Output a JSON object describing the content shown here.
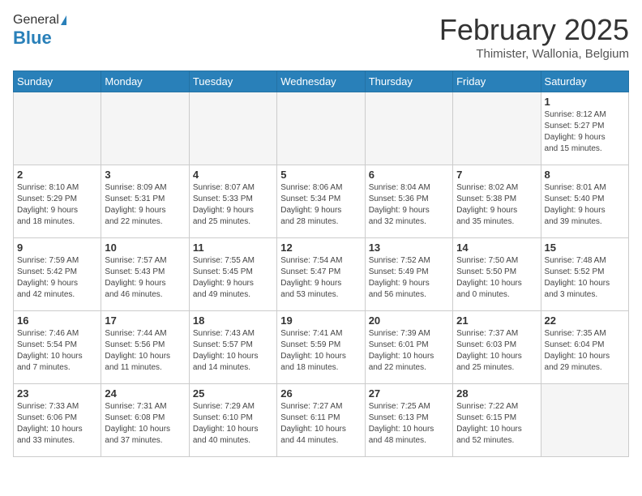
{
  "header": {
    "logo_general": "General",
    "logo_blue": "Blue",
    "month_title": "February 2025",
    "location": "Thimister, Wallonia, Belgium"
  },
  "weekdays": [
    "Sunday",
    "Monday",
    "Tuesday",
    "Wednesday",
    "Thursday",
    "Friday",
    "Saturday"
  ],
  "weeks": [
    [
      {
        "day": "",
        "info": ""
      },
      {
        "day": "",
        "info": ""
      },
      {
        "day": "",
        "info": ""
      },
      {
        "day": "",
        "info": ""
      },
      {
        "day": "",
        "info": ""
      },
      {
        "day": "",
        "info": ""
      },
      {
        "day": "1",
        "info": "Sunrise: 8:12 AM\nSunset: 5:27 PM\nDaylight: 9 hours\nand 15 minutes."
      }
    ],
    [
      {
        "day": "2",
        "info": "Sunrise: 8:10 AM\nSunset: 5:29 PM\nDaylight: 9 hours\nand 18 minutes."
      },
      {
        "day": "3",
        "info": "Sunrise: 8:09 AM\nSunset: 5:31 PM\nDaylight: 9 hours\nand 22 minutes."
      },
      {
        "day": "4",
        "info": "Sunrise: 8:07 AM\nSunset: 5:33 PM\nDaylight: 9 hours\nand 25 minutes."
      },
      {
        "day": "5",
        "info": "Sunrise: 8:06 AM\nSunset: 5:34 PM\nDaylight: 9 hours\nand 28 minutes."
      },
      {
        "day": "6",
        "info": "Sunrise: 8:04 AM\nSunset: 5:36 PM\nDaylight: 9 hours\nand 32 minutes."
      },
      {
        "day": "7",
        "info": "Sunrise: 8:02 AM\nSunset: 5:38 PM\nDaylight: 9 hours\nand 35 minutes."
      },
      {
        "day": "8",
        "info": "Sunrise: 8:01 AM\nSunset: 5:40 PM\nDaylight: 9 hours\nand 39 minutes."
      }
    ],
    [
      {
        "day": "9",
        "info": "Sunrise: 7:59 AM\nSunset: 5:42 PM\nDaylight: 9 hours\nand 42 minutes."
      },
      {
        "day": "10",
        "info": "Sunrise: 7:57 AM\nSunset: 5:43 PM\nDaylight: 9 hours\nand 46 minutes."
      },
      {
        "day": "11",
        "info": "Sunrise: 7:55 AM\nSunset: 5:45 PM\nDaylight: 9 hours\nand 49 minutes."
      },
      {
        "day": "12",
        "info": "Sunrise: 7:54 AM\nSunset: 5:47 PM\nDaylight: 9 hours\nand 53 minutes."
      },
      {
        "day": "13",
        "info": "Sunrise: 7:52 AM\nSunset: 5:49 PM\nDaylight: 9 hours\nand 56 minutes."
      },
      {
        "day": "14",
        "info": "Sunrise: 7:50 AM\nSunset: 5:50 PM\nDaylight: 10 hours\nand 0 minutes."
      },
      {
        "day": "15",
        "info": "Sunrise: 7:48 AM\nSunset: 5:52 PM\nDaylight: 10 hours\nand 3 minutes."
      }
    ],
    [
      {
        "day": "16",
        "info": "Sunrise: 7:46 AM\nSunset: 5:54 PM\nDaylight: 10 hours\nand 7 minutes."
      },
      {
        "day": "17",
        "info": "Sunrise: 7:44 AM\nSunset: 5:56 PM\nDaylight: 10 hours\nand 11 minutes."
      },
      {
        "day": "18",
        "info": "Sunrise: 7:43 AM\nSunset: 5:57 PM\nDaylight: 10 hours\nand 14 minutes."
      },
      {
        "day": "19",
        "info": "Sunrise: 7:41 AM\nSunset: 5:59 PM\nDaylight: 10 hours\nand 18 minutes."
      },
      {
        "day": "20",
        "info": "Sunrise: 7:39 AM\nSunset: 6:01 PM\nDaylight: 10 hours\nand 22 minutes."
      },
      {
        "day": "21",
        "info": "Sunrise: 7:37 AM\nSunset: 6:03 PM\nDaylight: 10 hours\nand 25 minutes."
      },
      {
        "day": "22",
        "info": "Sunrise: 7:35 AM\nSunset: 6:04 PM\nDaylight: 10 hours\nand 29 minutes."
      }
    ],
    [
      {
        "day": "23",
        "info": "Sunrise: 7:33 AM\nSunset: 6:06 PM\nDaylight: 10 hours\nand 33 minutes."
      },
      {
        "day": "24",
        "info": "Sunrise: 7:31 AM\nSunset: 6:08 PM\nDaylight: 10 hours\nand 37 minutes."
      },
      {
        "day": "25",
        "info": "Sunrise: 7:29 AM\nSunset: 6:10 PM\nDaylight: 10 hours\nand 40 minutes."
      },
      {
        "day": "26",
        "info": "Sunrise: 7:27 AM\nSunset: 6:11 PM\nDaylight: 10 hours\nand 44 minutes."
      },
      {
        "day": "27",
        "info": "Sunrise: 7:25 AM\nSunset: 6:13 PM\nDaylight: 10 hours\nand 48 minutes."
      },
      {
        "day": "28",
        "info": "Sunrise: 7:22 AM\nSunset: 6:15 PM\nDaylight: 10 hours\nand 52 minutes."
      },
      {
        "day": "",
        "info": ""
      }
    ]
  ]
}
